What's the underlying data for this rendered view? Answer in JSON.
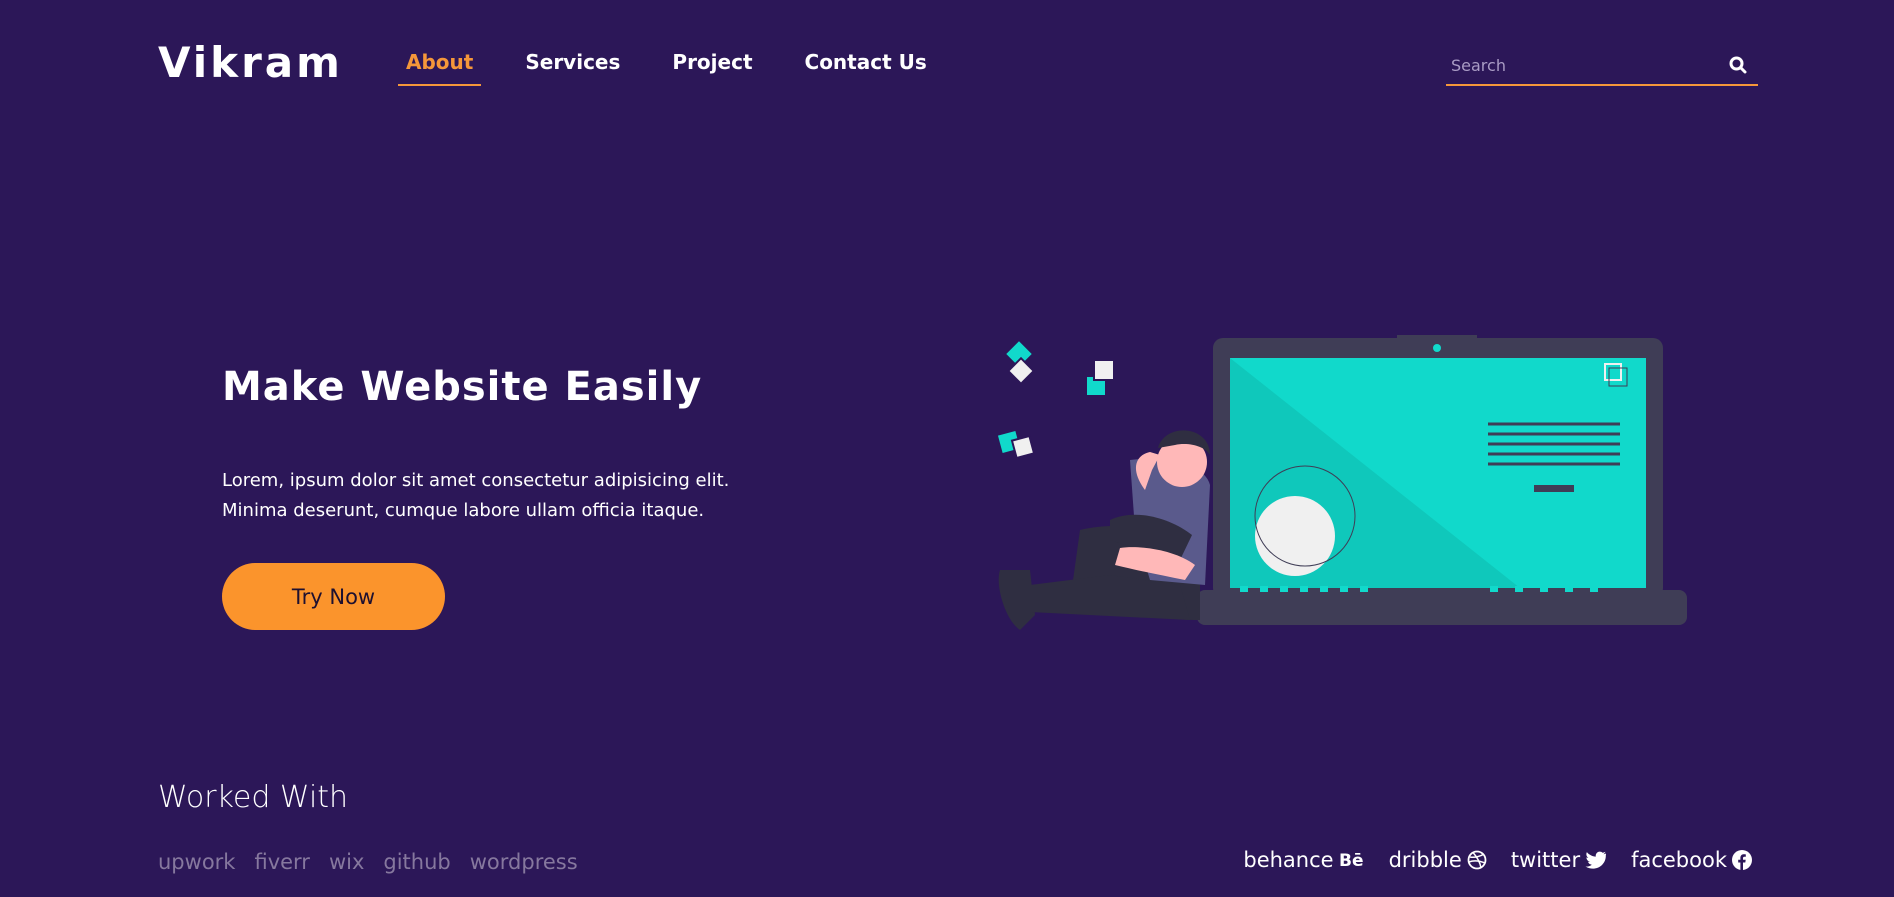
{
  "brand": {
    "logo": "Vikram"
  },
  "nav": {
    "items": [
      {
        "label": "About",
        "active": true
      },
      {
        "label": "Services",
        "active": false
      },
      {
        "label": "Project",
        "active": false
      },
      {
        "label": "Contact Us",
        "active": false
      }
    ]
  },
  "search": {
    "placeholder": "Search",
    "value": "",
    "icon": "search-icon"
  },
  "hero": {
    "title": "Make Website Easily",
    "line1": "Lorem, ipsum dolor sit amet consectetur adipisicing elit.",
    "line2": "Minima deserunt, cumque labore ullam officia itaque.",
    "cta_label": "Try Now"
  },
  "worked_with": {
    "title": "Worked With",
    "partners": [
      "upwork",
      "fiverr",
      "wix",
      "github",
      "wordpress"
    ]
  },
  "socials": [
    {
      "label": "behance",
      "icon": "behance-icon"
    },
    {
      "label": "dribble",
      "icon": "dribbble-icon"
    },
    {
      "label": "twitter",
      "icon": "twitter-icon"
    },
    {
      "label": "facebook",
      "icon": "facebook-icon"
    }
  ],
  "colors": {
    "background": "#2c1758",
    "accent": "#f5973a",
    "button": "#fb942c",
    "screen": "#11d9cb",
    "muted_link": "#86789e"
  }
}
